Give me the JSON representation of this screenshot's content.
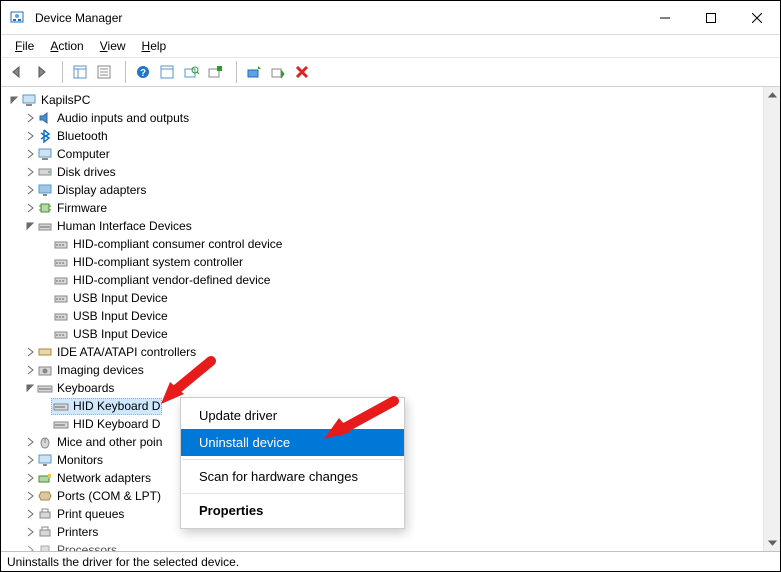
{
  "window": {
    "title": "Device Manager"
  },
  "menu": {
    "file": "File",
    "action": "Action",
    "view": "View",
    "help": "Help"
  },
  "tree": {
    "root": "KapilsPC",
    "audio": "Audio inputs and outputs",
    "bluetooth": "Bluetooth",
    "computer": "Computer",
    "disk": "Disk drives",
    "display": "Display adapters",
    "firmware": "Firmware",
    "hid": "Human Interface Devices",
    "hid_children": {
      "c0": "HID-compliant consumer control device",
      "c1": "HID-compliant system controller",
      "c2": "HID-compliant vendor-defined device",
      "c3": "USB Input Device",
      "c4": "USB Input Device",
      "c5": "USB Input Device"
    },
    "ide": "IDE ATA/ATAPI controllers",
    "imaging": "Imaging devices",
    "keyboards": "Keyboards",
    "kbd_children": {
      "k0": "HID Keyboard D",
      "k1": "HID Keyboard D"
    },
    "mice": "Mice and other poin",
    "monitors": "Monitors",
    "network": "Network adapters",
    "ports": "Ports (COM & LPT)",
    "printqueues": "Print queues",
    "printers": "Printers",
    "processors": "Processors"
  },
  "context_menu": {
    "update": "Update driver",
    "uninstall": "Uninstall device",
    "scan": "Scan for hardware changes",
    "properties": "Properties"
  },
  "statusbar": "Uninstalls the driver for the selected device."
}
